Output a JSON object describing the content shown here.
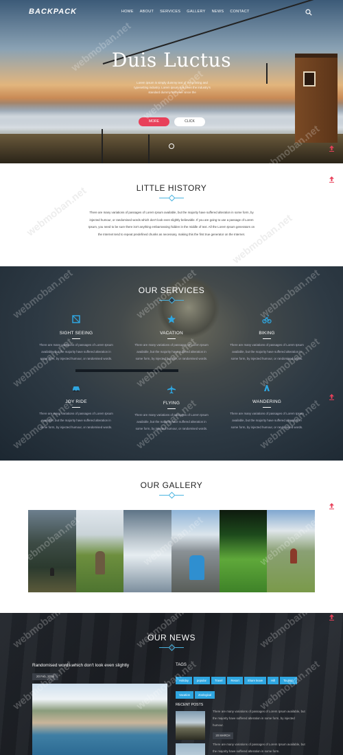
{
  "header": {
    "logo": "BACKPACK",
    "menu": [
      "HOME",
      "ABOUT",
      "SERVICES",
      "GALLERY",
      "NEWS",
      "CONTACT"
    ]
  },
  "hero": {
    "title": "Duis Luctus",
    "text": "Lorem ipsum is simply dummy text of the printing and typesetting industry. Lorem ipsum has been the industry's standard dummy text ever since the",
    "more_button": "MORE",
    "click_button": "CLICK"
  },
  "history": {
    "title": "LITTLE HISTORY",
    "text": "There are many variations of passages of Lorem Ipsum available, but the majority have suffered alteration in some form, by injected humour, or randomised words which don't look even slightly believable. If you are going to use a passage of Lorem Ipsum, you need to be sure there isn't anything embarrassing hidden in the middle of text. All the Lorem Ipsum generators on the Internet tend to repeat predefined chunks as necessary, making this the first true generator on the Internet."
  },
  "services": {
    "title": "OUR SERVICES",
    "items": [
      {
        "name": "SIGHT SEEING",
        "icon": "map-icon",
        "desc": "There are many variations of passages of Lorem Ipsum available, but the majority have suffered alteration in some form, by injected humour, or randomised words."
      },
      {
        "name": "VACATION",
        "icon": "star-icon",
        "desc": "There are many variations of passages of Lorem Ipsum available, but the majority have suffered alteration in some form, by injected humour, or randomised words."
      },
      {
        "name": "BIKING",
        "icon": "bike-icon",
        "desc": "There are many variations of passages of Lorem Ipsum available, but the majority have suffered alteration in some form, by injected humour, or randomised words."
      },
      {
        "name": "JOY RIDE",
        "icon": "car-icon",
        "desc": "There are many variations of passages of Lorem Ipsum available, but the majority have suffered alteration in some form, by injected humour, or randomised words."
      },
      {
        "name": "FLYING",
        "icon": "plane-icon",
        "desc": "There are many variations of passages of Lorem Ipsum available, but the majority have suffered alteration in some form, by injected humour, or randomised words."
      },
      {
        "name": "WANDERING",
        "icon": "compass-icon",
        "desc": "There are many variations of passages of Lorem Ipsum available, but the majority have suffered alteration in some form, by injected humour, or randomised words."
      }
    ]
  },
  "gallery": {
    "title": "OUR GALLERY"
  },
  "news": {
    "title": "OUR NEWS",
    "headline": "Randomised words which don't look even slightly",
    "date": "20 Feb, 2016",
    "tags_title": "TAGS",
    "tags": [
      "Holiday",
      "popular",
      "Travel",
      "Resort",
      "Share leave",
      "Hill",
      "Tourism",
      "Vacation",
      "Zoological"
    ],
    "recent_title": "RECENT POSTS",
    "recent": [
      {
        "text": "There are many variations of passages of Lorem Ipsum available, but the majority have suffered alteration in some form, by injected humour.",
        "date": "20 MARCH"
      },
      {
        "text": "There are many variations of passages of Lorem Ipsum available, but the majority have suffered alteration in some form.",
        "date": ""
      }
    ]
  },
  "watermark": "webmoban.net",
  "colors": {
    "accent": "#e8405a",
    "blue": "#2fa6e0",
    "divider": "#4ab4e0"
  }
}
